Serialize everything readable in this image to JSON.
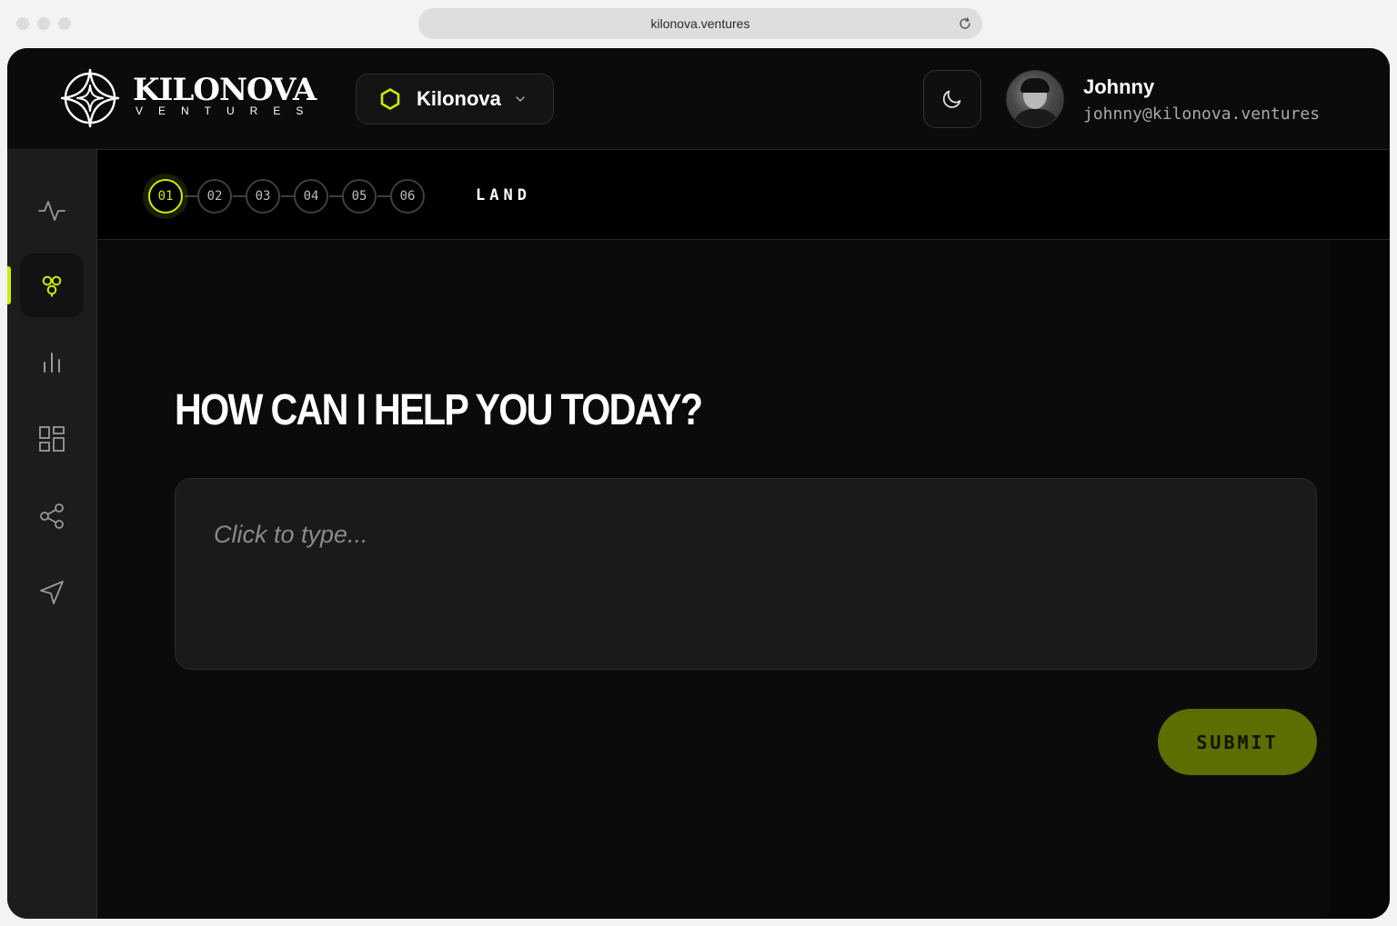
{
  "browser": {
    "url": "kilonova.ventures"
  },
  "header": {
    "logo_word": "KILONOVA",
    "logo_sub": "VENTURES",
    "workspace_label": "Kilonova",
    "user": {
      "name": "Johnny",
      "email": "johnny@kilonova.ventures"
    }
  },
  "sidebar": {
    "items": [
      {
        "icon": "activity-icon",
        "active": false
      },
      {
        "icon": "molecule-icon",
        "active": true
      },
      {
        "icon": "bar-chart-icon",
        "active": false
      },
      {
        "icon": "dashboard-grid-icon",
        "active": false
      },
      {
        "icon": "share-icon",
        "active": false
      },
      {
        "icon": "send-icon",
        "active": false
      }
    ]
  },
  "steps": {
    "items": [
      "01",
      "02",
      "03",
      "04",
      "05",
      "06"
    ],
    "active_index": 0,
    "label": "LAND"
  },
  "main": {
    "headline": "HOW CAN I HELP YOU TODAY?",
    "input_placeholder": "Click to type...",
    "submit_label": "SUBMIT"
  },
  "colors": {
    "accent": "#c8f000",
    "submit_bg": "#5c6e00",
    "background": "#0b0b0b",
    "sidebar_bg": "#1c1c1c"
  }
}
